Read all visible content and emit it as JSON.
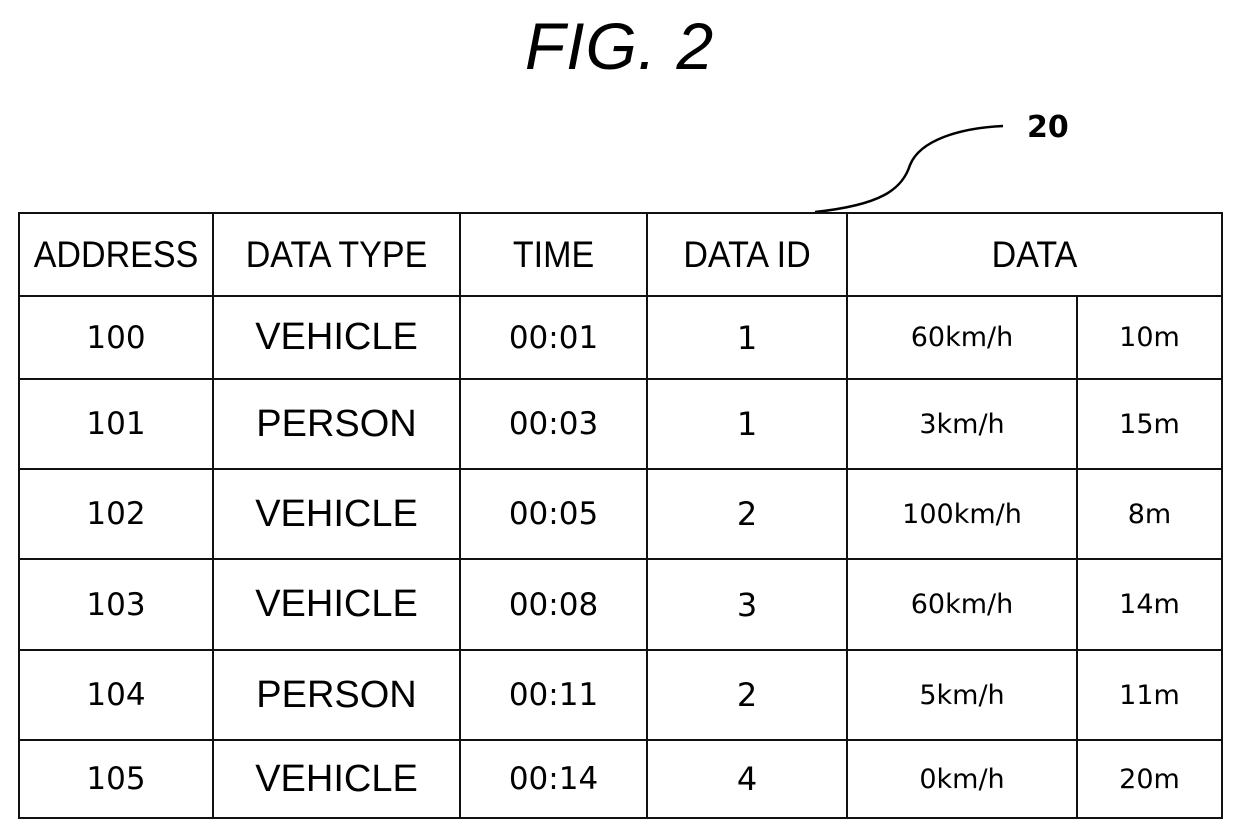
{
  "figure": {
    "title": "FIG. 2",
    "reference_numeral": "20"
  },
  "table": {
    "headers": [
      "ADDRESS",
      "DATA TYPE",
      "TIME",
      "DATA ID",
      "DATA"
    ],
    "rows": [
      {
        "address": "100",
        "data_type": "VEHICLE",
        "time": "00:01",
        "data_id": "1",
        "speed": "60km/h",
        "distance": "10m"
      },
      {
        "address": "101",
        "data_type": "PERSON",
        "time": "00:03",
        "data_id": "1",
        "speed": "3km/h",
        "distance": "15m"
      },
      {
        "address": "102",
        "data_type": "VEHICLE",
        "time": "00:05",
        "data_id": "2",
        "speed": "100km/h",
        "distance": "8m"
      },
      {
        "address": "103",
        "data_type": "VEHICLE",
        "time": "00:08",
        "data_id": "3",
        "speed": "60km/h",
        "distance": "14m"
      },
      {
        "address": "104",
        "data_type": "PERSON",
        "time": "00:11",
        "data_id": "2",
        "speed": "5km/h",
        "distance": "11m"
      },
      {
        "address": "105",
        "data_type": "VEHICLE",
        "time": "00:14",
        "data_id": "4",
        "speed": "0km/h",
        "distance": "20m"
      }
    ]
  }
}
